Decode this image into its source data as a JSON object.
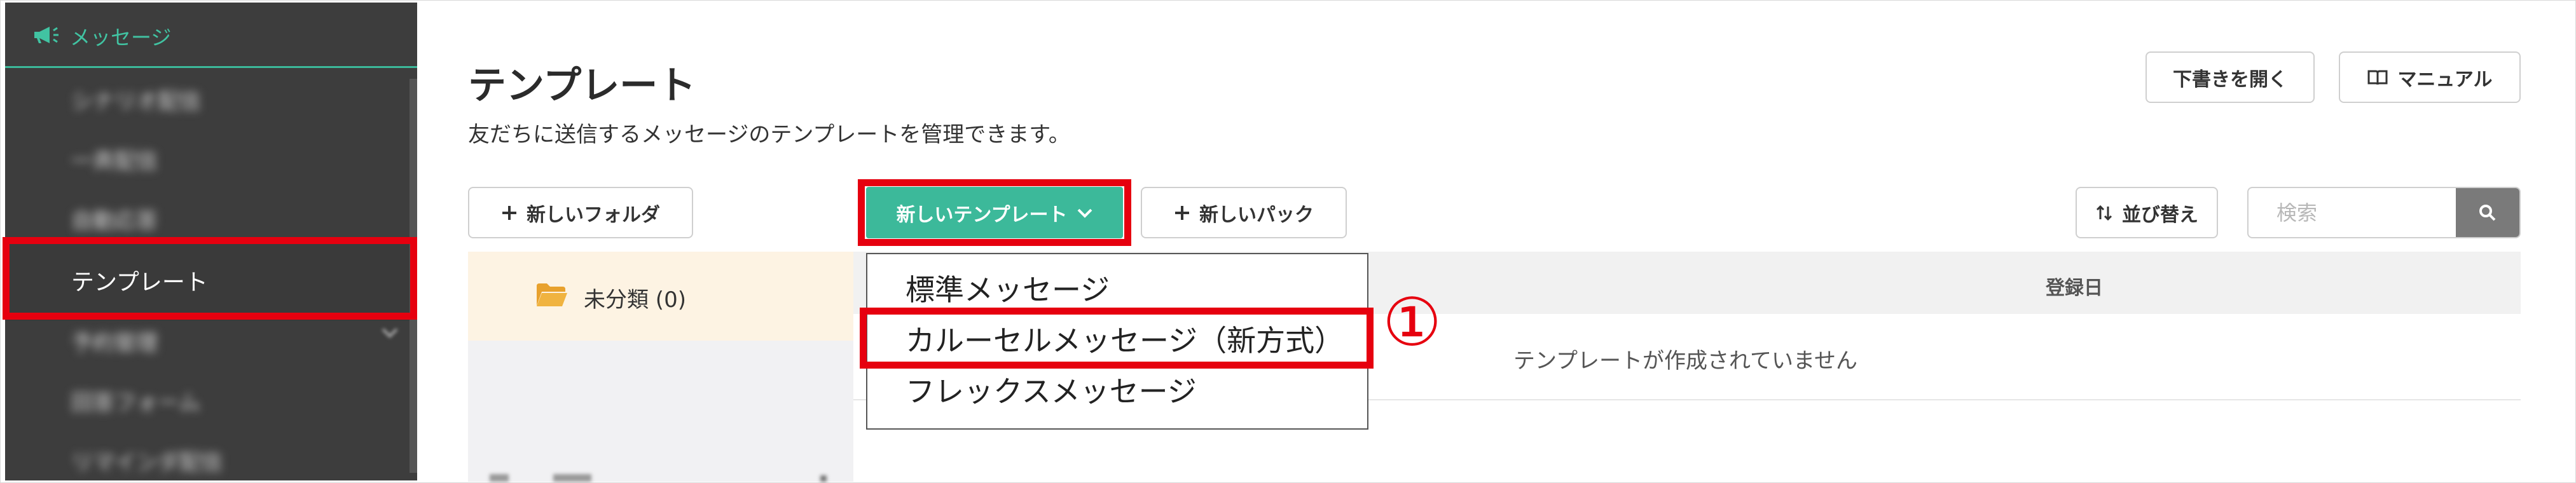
{
  "sidebar": {
    "section_label": "メッセージ",
    "items": [
      {
        "label": "シナリオ配信"
      },
      {
        "label": "一斉配信"
      },
      {
        "label": "自動応答"
      },
      {
        "label": "テンプレート"
      },
      {
        "label": "予約管理"
      },
      {
        "label": "回答フォーム"
      },
      {
        "label": "リマインダ配信"
      }
    ]
  },
  "header": {
    "title": "テンプレート",
    "description": "友だちに送信するメッセージのテンプレートを管理できます。",
    "draft_button": "下書きを開く",
    "manual_button": "マニュアル"
  },
  "toolbar": {
    "new_folder": "新しいフォルダ",
    "new_template": "新しいテンプレート",
    "new_pack": "新しいパック",
    "sort": "並び替え",
    "search_placeholder": "検索"
  },
  "folders": [
    {
      "name": "未分類 (0)"
    }
  ],
  "table": {
    "column_registered": "登録日",
    "empty_message": "テンプレートが作成されていません"
  },
  "dropdown": {
    "items": [
      "標準メッセージ",
      "カルーセルメッセージ（新方式）",
      "フレックスメッセージ"
    ]
  },
  "annotation": {
    "step_marker": "①"
  },
  "colors": {
    "accent": "#3cb99a",
    "highlight": "#e6000f",
    "sidebar_bg": "#3d3d3d",
    "folder_selected": "#fdf3e3"
  }
}
